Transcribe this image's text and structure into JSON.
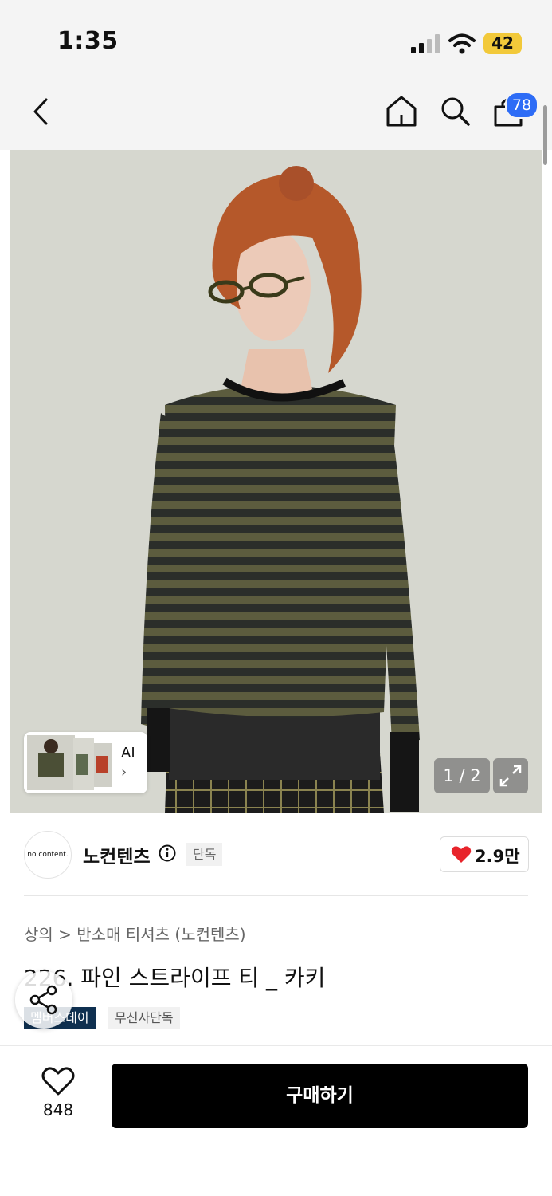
{
  "status_bar": {
    "time": "1:35",
    "battery": "42"
  },
  "nav": {
    "cart_count": "78"
  },
  "gallery": {
    "counter": "1 / 2",
    "ai_label": "AI",
    "ai_arrow": "›"
  },
  "brand": {
    "logo_text": "no content.",
    "name": "노컨텐츠",
    "exclusive_badge": "단독",
    "likes": "2.9만"
  },
  "product": {
    "breadcrumb": "상의 > 반소매 티셔츠 (노컨텐츠)",
    "title": "226. 파인 스트라이프 티 _ 카키",
    "tags": [
      "멤버스데이",
      "무신사단독"
    ]
  },
  "bottom_bar": {
    "favorite_count": "848",
    "buy_label": "구매하기"
  },
  "colors": {
    "accent_blue": "#2d6cf6",
    "heart_red": "#e8242b",
    "tag_navy": "#0f3050",
    "battery_yellow": "#f2c93a"
  }
}
